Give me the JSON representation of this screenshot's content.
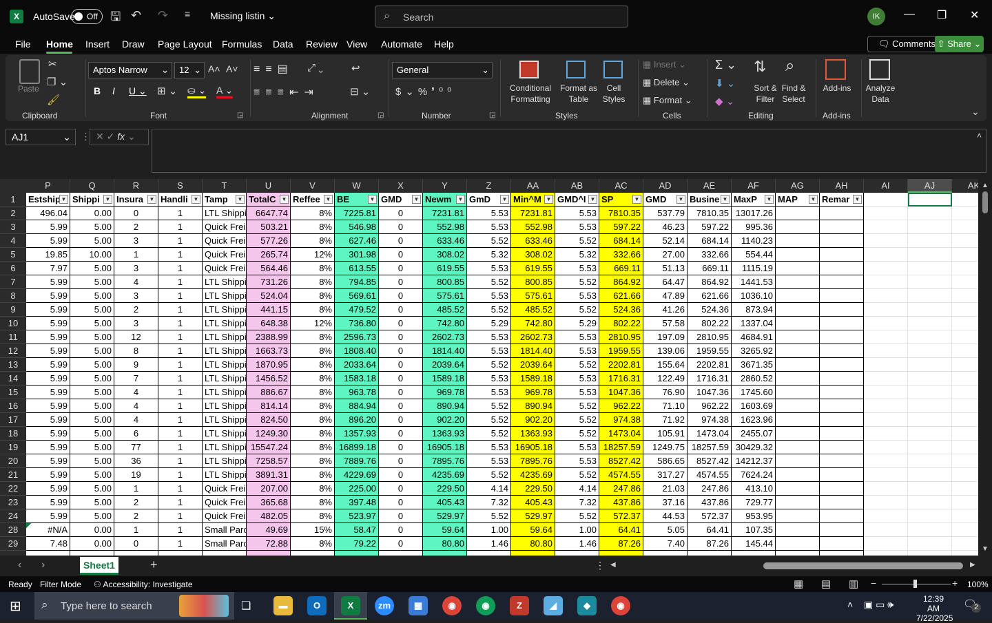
{
  "titlebar": {
    "autosave_label": "AutoSave",
    "autosave_state": "Off",
    "doc_title": "Missing listin",
    "search_placeholder": "Search",
    "avatar_initials": "IK"
  },
  "menu": [
    "File",
    "Home",
    "Insert",
    "Draw",
    "Page Layout",
    "Formulas",
    "Data",
    "Review",
    "View",
    "Automate",
    "Help"
  ],
  "comments_label": "Comments",
  "share_label": "Share",
  "ribbon": {
    "paste": "Paste",
    "clipboard": "Clipboard",
    "font_name": "Aptos Narrow",
    "font_size": "12",
    "font": "Font",
    "alignment": "Alignment",
    "number_format": "General",
    "number": "Number",
    "conditional_formatting": "Conditional Formatting",
    "format_as_table": "Format as Table",
    "cell_styles": "Cell Styles",
    "styles": "Styles",
    "insert": "Insert",
    "delete": "Delete",
    "format": "Format",
    "cells": "Cells",
    "sort_filter": "Sort & Filter",
    "find_select": "Find & Select",
    "editing": "Editing",
    "add_ins": "Add-ins",
    "add_ins_group": "Add-ins",
    "analyze_data": "Analyze Data"
  },
  "name_box": "AJ1",
  "columns": [
    "P",
    "Q",
    "R",
    "S",
    "T",
    "U",
    "V",
    "W",
    "X",
    "Y",
    "Z",
    "AA",
    "AB",
    "AC",
    "AD",
    "AE",
    "AF",
    "AG",
    "AH",
    "AI",
    "AJ",
    "AK"
  ],
  "headers": [
    "Estship",
    "Shippi",
    "Insura",
    "Handli",
    "Tamp",
    "TotalC",
    "Reffee",
    "BE",
    "GMD",
    "Newm",
    "GmD",
    "Min^M",
    "GMD^I",
    "SP",
    "GMD",
    "Busine",
    "MaxP",
    "MAP",
    "Remar"
  ],
  "rows": [
    {
      "n": "2",
      "v": [
        "496.04",
        "0.00",
        "0",
        "1",
        "LTL Shippi",
        "6647.74",
        "8%",
        "7225.81",
        "0",
        "7231.81",
        "5.53",
        "7231.81",
        "5.53",
        "7810.35",
        "537.79",
        "7810.35",
        "13017.26",
        "",
        ""
      ]
    },
    {
      "n": "3",
      "v": [
        "5.99",
        "5.00",
        "2",
        "1",
        "Quick Frei",
        "503.21",
        "8%",
        "546.98",
        "0",
        "552.98",
        "5.53",
        "552.98",
        "5.53",
        "597.22",
        "46.23",
        "597.22",
        "995.36",
        "",
        ""
      ]
    },
    {
      "n": "4",
      "v": [
        "5.99",
        "5.00",
        "3",
        "1",
        "Quick Frei",
        "577.26",
        "8%",
        "627.46",
        "0",
        "633.46",
        "5.52",
        "633.46",
        "5.52",
        "684.14",
        "52.14",
        "684.14",
        "1140.23",
        "",
        ""
      ]
    },
    {
      "n": "5",
      "v": [
        "19.85",
        "10.00",
        "1",
        "1",
        "Quick Frei",
        "265.74",
        "12%",
        "301.98",
        "0",
        "308.02",
        "5.32",
        "308.02",
        "5.32",
        "332.66",
        "27.00",
        "332.66",
        "554.44",
        "",
        ""
      ]
    },
    {
      "n": "6",
      "v": [
        "7.97",
        "5.00",
        "3",
        "1",
        "Quick Frei",
        "564.46",
        "8%",
        "613.55",
        "0",
        "619.55",
        "5.53",
        "619.55",
        "5.53",
        "669.11",
        "51.13",
        "669.11",
        "1115.19",
        "",
        ""
      ]
    },
    {
      "n": "7",
      "v": [
        "5.99",
        "5.00",
        "4",
        "1",
        "LTL Shippi",
        "731.26",
        "8%",
        "794.85",
        "0",
        "800.85",
        "5.52",
        "800.85",
        "5.52",
        "864.92",
        "64.47",
        "864.92",
        "1441.53",
        "",
        ""
      ]
    },
    {
      "n": "8",
      "v": [
        "5.99",
        "5.00",
        "3",
        "1",
        "LTL Shippi",
        "524.04",
        "8%",
        "569.61",
        "0",
        "575.61",
        "5.53",
        "575.61",
        "5.53",
        "621.66",
        "47.89",
        "621.66",
        "1036.10",
        "",
        ""
      ]
    },
    {
      "n": "9",
      "v": [
        "5.99",
        "5.00",
        "2",
        "1",
        "LTL Shippi",
        "441.15",
        "8%",
        "479.52",
        "0",
        "485.52",
        "5.52",
        "485.52",
        "5.52",
        "524.36",
        "41.26",
        "524.36",
        "873.94",
        "",
        ""
      ]
    },
    {
      "n": "10",
      "v": [
        "5.99",
        "5.00",
        "3",
        "1",
        "LTL Shippi",
        "648.38",
        "12%",
        "736.80",
        "0",
        "742.80",
        "5.29",
        "742.80",
        "5.29",
        "802.22",
        "57.58",
        "802.22",
        "1337.04",
        "",
        ""
      ]
    },
    {
      "n": "11",
      "v": [
        "5.99",
        "5.00",
        "12",
        "1",
        "LTL Shippi",
        "2388.99",
        "8%",
        "2596.73",
        "0",
        "2602.73",
        "5.53",
        "2602.73",
        "5.53",
        "2810.95",
        "197.09",
        "2810.95",
        "4684.91",
        "",
        ""
      ]
    },
    {
      "n": "12",
      "v": [
        "5.99",
        "5.00",
        "8",
        "1",
        "LTL Shippi",
        "1663.73",
        "8%",
        "1808.40",
        "0",
        "1814.40",
        "5.53",
        "1814.40",
        "5.53",
        "1959.55",
        "139.06",
        "1959.55",
        "3265.92",
        "",
        ""
      ]
    },
    {
      "n": "13",
      "v": [
        "5.99",
        "5.00",
        "9",
        "1",
        "LTL Shippi",
        "1870.95",
        "8%",
        "2033.64",
        "0",
        "2039.64",
        "5.52",
        "2039.64",
        "5.52",
        "2202.81",
        "155.64",
        "2202.81",
        "3671.35",
        "",
        ""
      ]
    },
    {
      "n": "14",
      "v": [
        "5.99",
        "5.00",
        "7",
        "1",
        "LTL Shippi",
        "1456.52",
        "8%",
        "1583.18",
        "0",
        "1589.18",
        "5.53",
        "1589.18",
        "5.53",
        "1716.31",
        "122.49",
        "1716.31",
        "2860.52",
        "",
        ""
      ]
    },
    {
      "n": "15",
      "v": [
        "5.99",
        "5.00",
        "4",
        "1",
        "LTL Shippi",
        "886.67",
        "8%",
        "963.78",
        "0",
        "969.78",
        "5.53",
        "969.78",
        "5.53",
        "1047.36",
        "76.90",
        "1047.36",
        "1745.60",
        "",
        ""
      ]
    },
    {
      "n": "16",
      "v": [
        "5.99",
        "5.00",
        "4",
        "1",
        "LTL Shippi",
        "814.14",
        "8%",
        "884.94",
        "0",
        "890.94",
        "5.52",
        "890.94",
        "5.52",
        "962.22",
        "71.10",
        "962.22",
        "1603.69",
        "",
        ""
      ]
    },
    {
      "n": "17",
      "v": [
        "5.99",
        "5.00",
        "4",
        "1",
        "LTL Shippi",
        "824.50",
        "8%",
        "896.20",
        "0",
        "902.20",
        "5.52",
        "902.20",
        "5.52",
        "974.38",
        "71.92",
        "974.38",
        "1623.96",
        "",
        ""
      ]
    },
    {
      "n": "18",
      "v": [
        "5.99",
        "5.00",
        "6",
        "1",
        "LTL Shippi",
        "1249.30",
        "8%",
        "1357.93",
        "0",
        "1363.93",
        "5.52",
        "1363.93",
        "5.52",
        "1473.04",
        "105.91",
        "1473.04",
        "2455.07",
        "",
        ""
      ]
    },
    {
      "n": "19",
      "v": [
        "5.99",
        "5.00",
        "77",
        "1",
        "LTL Shippi",
        "15547.24",
        "8%",
        "16899.18",
        "0",
        "16905.18",
        "5.53",
        "16905.18",
        "5.53",
        "18257.59",
        "1249.75",
        "18257.59",
        "30429.32",
        "",
        ""
      ]
    },
    {
      "n": "20",
      "v": [
        "5.99",
        "5.00",
        "36",
        "1",
        "LTL Shippi",
        "7258.57",
        "8%",
        "7889.76",
        "0",
        "7895.76",
        "5.53",
        "7895.76",
        "5.53",
        "8527.42",
        "586.65",
        "8527.42",
        "14212.37",
        "",
        ""
      ]
    },
    {
      "n": "21",
      "v": [
        "5.99",
        "5.00",
        "19",
        "1",
        "LTL Shippi",
        "3891.31",
        "8%",
        "4229.69",
        "0",
        "4235.69",
        "5.52",
        "4235.69",
        "5.52",
        "4574.55",
        "317.27",
        "4574.55",
        "7624.24",
        "",
        ""
      ]
    },
    {
      "n": "22",
      "v": [
        "5.99",
        "5.00",
        "1",
        "1",
        "Quick Frei",
        "207.00",
        "8%",
        "225.00",
        "0",
        "229.50",
        "4.14",
        "229.50",
        "4.14",
        "247.86",
        "21.03",
        "247.86",
        "413.10",
        "",
        ""
      ]
    },
    {
      "n": "23",
      "v": [
        "5.99",
        "5.00",
        "2",
        "1",
        "Quick Frei",
        "365.68",
        "8%",
        "397.48",
        "0",
        "405.43",
        "7.32",
        "405.43",
        "7.32",
        "437.86",
        "37.16",
        "437.86",
        "729.77",
        "",
        ""
      ]
    },
    {
      "n": "24",
      "v": [
        "5.99",
        "5.00",
        "2",
        "1",
        "Quick Frei",
        "482.05",
        "8%",
        "523.97",
        "0",
        "529.97",
        "5.52",
        "529.97",
        "5.52",
        "572.37",
        "44.53",
        "572.37",
        "953.95",
        "",
        ""
      ]
    },
    {
      "n": "28",
      "v": [
        "#N/A",
        "0.00",
        "1",
        "1",
        "Small Parc",
        "49.69",
        "15%",
        "58.47",
        "0",
        "59.64",
        "1.00",
        "59.64",
        "1.00",
        "64.41",
        "5.05",
        "64.41",
        "107.35",
        "",
        ""
      ]
    },
    {
      "n": "29",
      "v": [
        "7.48",
        "0.00",
        "0",
        "1",
        "Small Parc",
        "72.88",
        "8%",
        "79.22",
        "0",
        "80.80",
        "1.46",
        "80.80",
        "1.46",
        "87.26",
        "7.40",
        "87.26",
        "145.44",
        "",
        ""
      ]
    }
  ],
  "sheet_tab": "Sheet1",
  "status": {
    "ready": "Ready",
    "filter_mode": "Filter Mode",
    "accessibility": "Accessibility: Investigate",
    "zoom": "100%"
  },
  "taskbar": {
    "search_placeholder": "Type here to search",
    "time": "12:39 AM",
    "date": "7/22/2025",
    "notifications": "2"
  },
  "colors": {
    "pink": "#f4c6ec",
    "green": "#5ff5c3",
    "yellow": "#ffff00",
    "accent": "#107c41"
  }
}
